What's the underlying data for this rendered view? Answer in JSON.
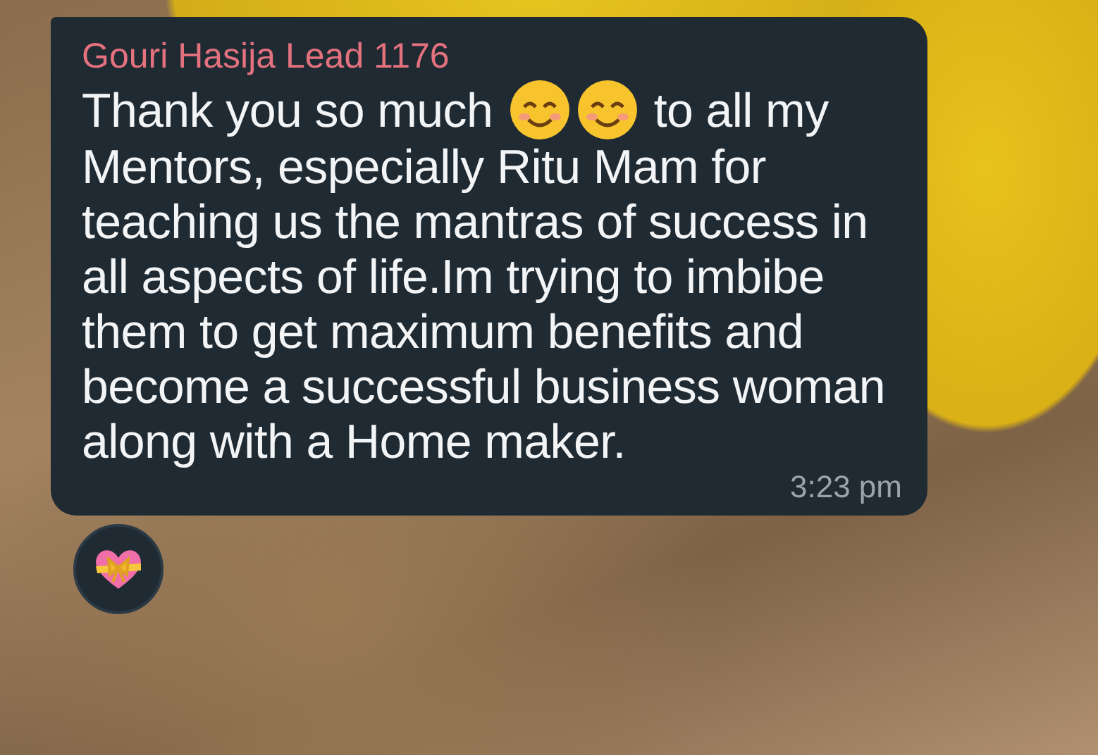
{
  "message": {
    "sender": "Gouri Hasija Lead 1176",
    "body": [
      {
        "kind": "text",
        "text": "Thank you so much "
      },
      {
        "kind": "emoji"
      },
      {
        "kind": "emoji"
      },
      {
        "kind": "text",
        "text": " to all my Mentors, especially Ritu Mam for teaching us the mantras of success in all aspects of life.Im trying to imbibe them to get maximum benefits and become a successful business woman along with a Home maker."
      }
    ],
    "time": "3:23 pm",
    "reaction": {
      "kind": "heart-ribbon"
    }
  }
}
